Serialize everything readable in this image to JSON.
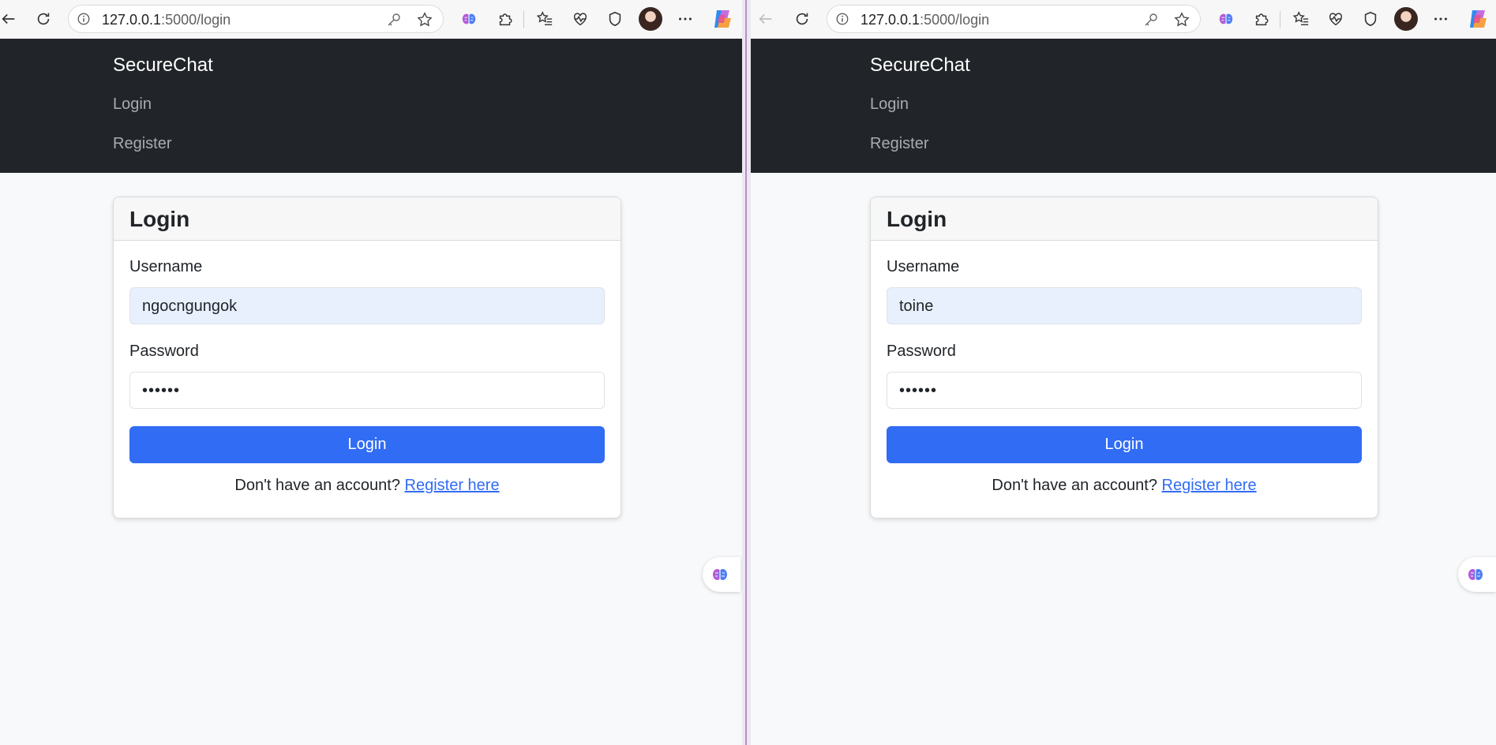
{
  "windows": [
    {
      "browser": {
        "url_host": "127.0.0.1",
        "url_rest": ":5000/login"
      },
      "navbar": {
        "brand": "SecureChat",
        "links": [
          "Login",
          "Register"
        ]
      },
      "login_card": {
        "title": "Login",
        "username_label": "Username",
        "username_value": "ngocngungok",
        "password_label": "Password",
        "password_value": "••••••",
        "submit_label": "Login",
        "footer_text": "Don't have an account?",
        "footer_link": "Register here"
      }
    },
    {
      "browser": {
        "url_host": "127.0.0.1",
        "url_rest": ":5000/login"
      },
      "navbar": {
        "brand": "SecureChat",
        "links": [
          "Login",
          "Register"
        ]
      },
      "login_card": {
        "title": "Login",
        "username_label": "Username",
        "username_value": "toine",
        "password_label": "Password",
        "password_value": "••••••",
        "submit_label": "Login",
        "footer_text": "Don't have an account?",
        "footer_link": "Register here"
      }
    }
  ],
  "icons": {
    "back": "back-arrow-icon",
    "reload": "reload-icon",
    "site_info": "info-icon",
    "password_key": "key-icon",
    "favorite": "star-icon",
    "extension_brain": "brain-icon",
    "extensions": "puzzle-icon",
    "favorites_list": "favorites-icon",
    "health": "heartbeat-icon",
    "shield": "shield-icon",
    "profile": "avatar",
    "more": "more-icon",
    "copilot": "copilot-icon"
  },
  "colors": {
    "navbar_bg": "#212529",
    "primary": "#316cf4",
    "autofill_bg": "#e8f0fe",
    "page_bg": "#f8f9fa"
  }
}
